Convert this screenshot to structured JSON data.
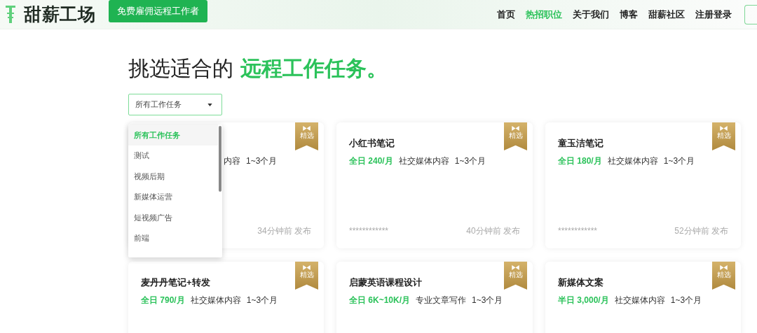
{
  "header": {
    "logo": "甜薪工场",
    "cta": "免费雇佣远程工作者",
    "nav": [
      {
        "label": "首页",
        "selected": false
      },
      {
        "label": "热招职位",
        "selected": true
      },
      {
        "label": "关于我们",
        "selected": false
      },
      {
        "label": "博客",
        "selected": false
      },
      {
        "label": "甜薪社区",
        "selected": false
      },
      {
        "label": "注册登录",
        "selected": false
      }
    ]
  },
  "heading": {
    "text": "挑选适合的",
    "highlight": "远程工作任务。"
  },
  "filter": {
    "value": "所有工作任务",
    "expanded": true,
    "options": [
      {
        "label": "所有工作任务",
        "selected": true
      },
      {
        "label": "测试",
        "selected": false
      },
      {
        "label": "视频后期",
        "selected": false
      },
      {
        "label": "新媒体运营",
        "selected": false
      },
      {
        "label": "短视频广告",
        "selected": false
      },
      {
        "label": "前端",
        "selected": false
      }
    ]
  },
  "jobs": [
    {
      "category": "内容",
      "duration": "1~3个月",
      "posted": "34分钟前 发布",
      "badge": "精选"
    },
    {
      "title": "小红书笔记",
      "type": "全日",
      "pay": "240/月",
      "category": "社交媒体内容",
      "duration": "1~3个月",
      "poster": "************",
      "posted": "40分钟前 发布",
      "badge": "精选"
    },
    {
      "title": "童玉洁笔记",
      "type": "全日",
      "pay": "180/月",
      "category": "社交媒体内容",
      "duration": "1~3个月",
      "poster": "************",
      "posted": "52分钟前 发布",
      "badge": "精选"
    },
    {
      "title": "麦丹丹笔记+转发",
      "type": "全日",
      "pay": "790/月",
      "category": "社交媒体内容",
      "duration": "1~3个月",
      "badge": "精选"
    },
    {
      "title": "启蒙英语课程设计",
      "type": "全日",
      "pay": "6K~10K/月",
      "category": "专业文章写作",
      "duration": "1~3个月",
      "badge": "精选"
    },
    {
      "title": "新媒体文案",
      "type": "半日",
      "pay": "3,000/月",
      "category": "社交媒体内容",
      "duration": "1~3个月",
      "badge": "精选"
    }
  ]
}
